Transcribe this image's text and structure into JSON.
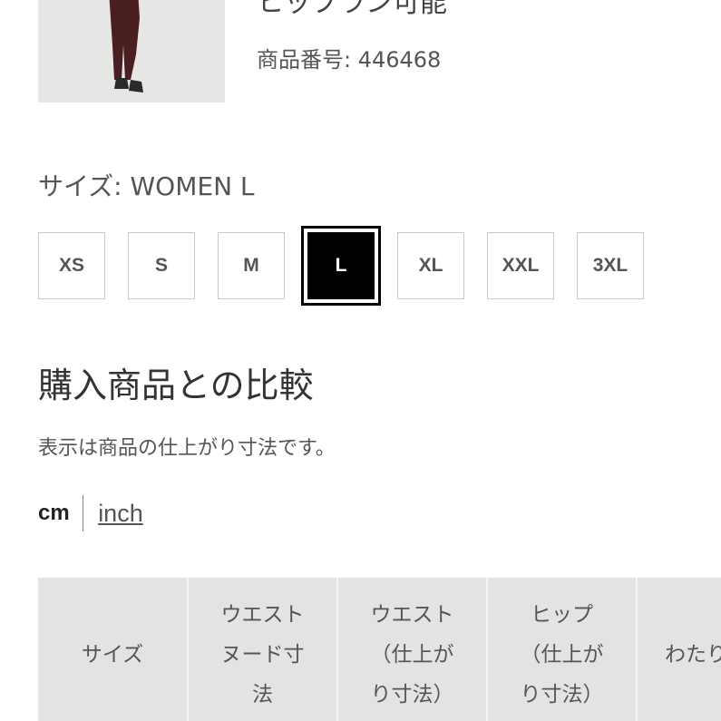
{
  "product": {
    "name": "ヒップラン可能",
    "id_text": "商品番号: 446468"
  },
  "size": {
    "label": "サイズ: WOMEN L",
    "options": [
      "XS",
      "S",
      "M",
      "L",
      "XL",
      "XXL",
      "3XL"
    ],
    "selected": "L"
  },
  "compare": {
    "title": "購入商品との比較",
    "note": "表示は商品の仕上がり寸法です。"
  },
  "units": {
    "cm": "cm",
    "inch": "inch",
    "active": "cm"
  },
  "table": {
    "headers": [
      "サイズ",
      "ウエスト\nヌード寸\n法",
      "ウエスト\n（仕上が\nり寸法）",
      "ヒップ\n（仕上が\nり寸法）",
      "わたり"
    ]
  }
}
